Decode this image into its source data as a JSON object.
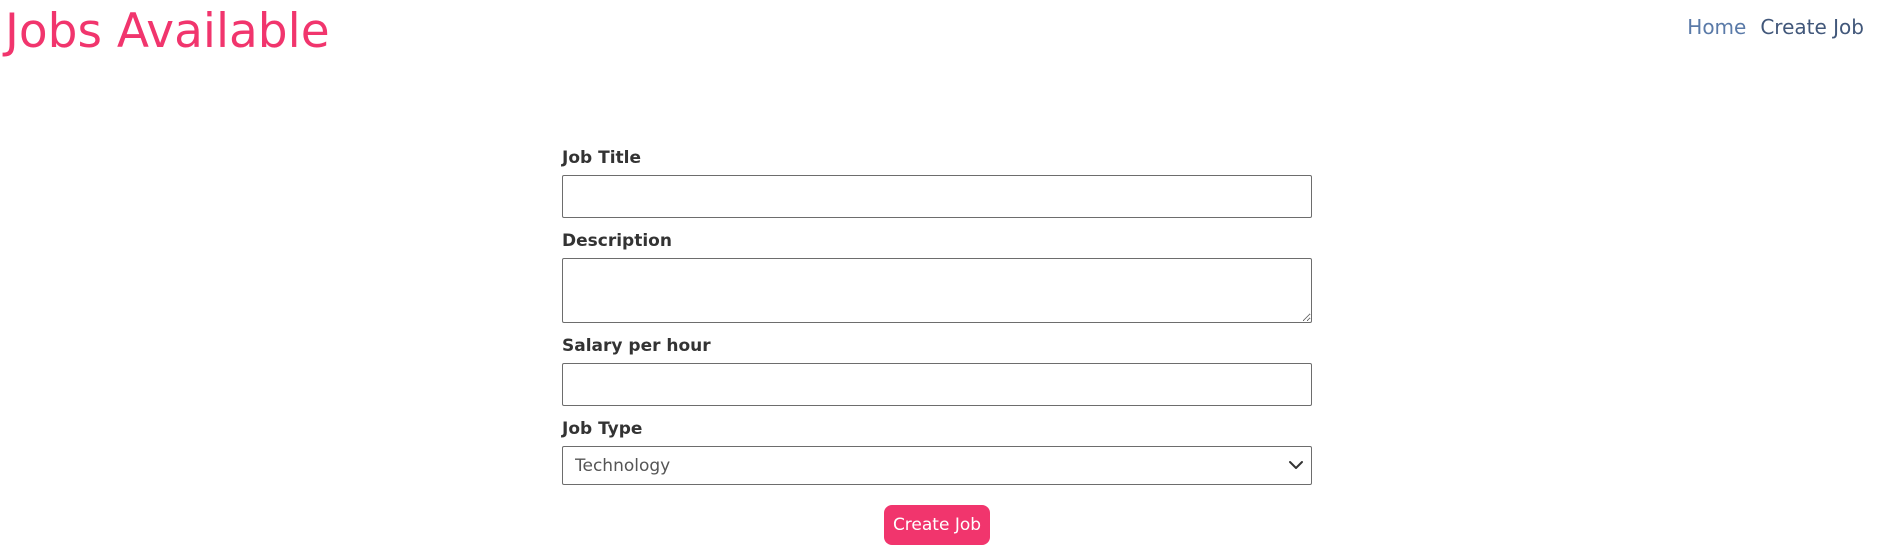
{
  "header": {
    "title": "Jobs Available",
    "nav": {
      "home_label": "Home",
      "create_label": "Create Job"
    }
  },
  "form": {
    "job_title": {
      "label": "Job Title",
      "value": "",
      "placeholder": ""
    },
    "description": {
      "label": "Description",
      "value": "",
      "placeholder": ""
    },
    "salary": {
      "label": "Salary per hour",
      "value": "",
      "placeholder": ""
    },
    "job_type": {
      "label": "Job Type",
      "selected": "Technology"
    },
    "submit_label": "Create Job"
  },
  "colors": {
    "accent": "#f1356d",
    "nav_link": "#5a7aa8",
    "nav_link_dark": "#41577a",
    "text": "#333333",
    "border": "#6d6d6d"
  },
  "icons": {
    "select_chevron": "chevron-down-icon",
    "resize_handle": "resize-handle-icon"
  }
}
